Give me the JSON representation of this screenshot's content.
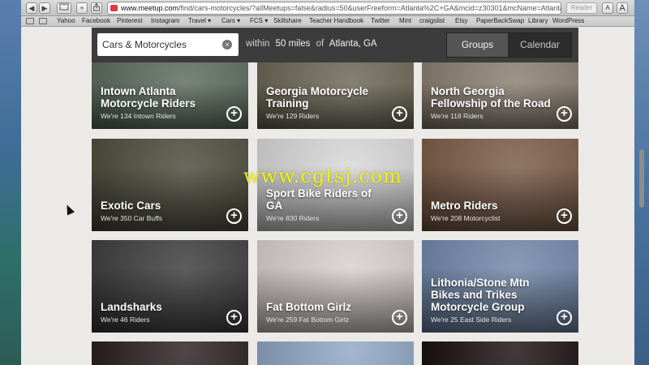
{
  "browser": {
    "url_host": "www.meetup.com",
    "url_path": "/find/cars-motorcycles/?allMeetups=false&radius=50&userFreeform=Atlanta%2C+GA&mcid=z30301&mcName=Atlanta%",
    "reader_label": "Reader",
    "nav": {
      "back": "◀",
      "forward": "▶",
      "bookmarks": "📖",
      "add": "+",
      "share": "⇪"
    },
    "font_small": "A",
    "font_large": "A"
  },
  "bookmarks": [
    {
      "label": "Yahoo"
    },
    {
      "label": "Facebook"
    },
    {
      "label": "Pinterest"
    },
    {
      "label": "Instagram"
    },
    {
      "label": "Travel ▾"
    },
    {
      "label": "Cars ▾"
    },
    {
      "label": "FCS ▾"
    },
    {
      "label": "Skillshare"
    },
    {
      "label": "Teacher Handbook"
    },
    {
      "label": "Twitter"
    },
    {
      "label": "Mint"
    },
    {
      "label": "craigslist"
    },
    {
      "label": "Etsy"
    },
    {
      "label": "PaperBackSwap"
    },
    {
      "label": "Library"
    },
    {
      "label": "WordPress"
    }
  ],
  "search": {
    "query": "Cars & Motorcycles",
    "within_label": "within",
    "radius": "50 miles",
    "of_label": "of",
    "location": "Atlanta, GA",
    "tabs": [
      {
        "label": "Groups",
        "active": true
      },
      {
        "label": "Calendar",
        "active": false
      }
    ]
  },
  "groups": [
    {
      "title": "Intown Atlanta Motorcycle Riders",
      "members": "We're 134 Intown Riders",
      "bg": "#5b6a5c"
    },
    {
      "title": "Georgia Motorcycle Training",
      "members": "We're 129 Riders",
      "bg": "#6b6654"
    },
    {
      "title": "North Georgia Fellowship of the Road",
      "members": "We're 118 Riders",
      "bg": "#8a7e70"
    },
    {
      "title": "Exotic Cars",
      "members": "We're 350 Car Buffs",
      "bg": "#4a4a3a"
    },
    {
      "title": "Sport Bike Riders of GA",
      "members": "We're 830 Riders",
      "bg": "#d8d8d8"
    },
    {
      "title": "Metro Riders",
      "members": "We're 208 Motorcyclist",
      "bg": "#7a5a44"
    },
    {
      "title": "Landsharks",
      "members": "We're 46 Riders",
      "bg": "#3b3b3b"
    },
    {
      "title": "Fat Bottom Girlz",
      "members": "We're 259 Fat Bottom Girlz",
      "bg": "#d9d0d0"
    },
    {
      "title": "Lithonia/Stone Mtn Bikes and Trikes Motorcycle Group",
      "members": "We're 25 East Side Riders",
      "bg": "#6f86a8"
    },
    {
      "title": "",
      "members": "",
      "bg": "#2a2020"
    },
    {
      "title": "",
      "members": "",
      "bg": "#8fa7c4"
    },
    {
      "title": "",
      "members": "",
      "bg": "#1a1010"
    }
  ],
  "watermark": "www.cgtsj.com"
}
